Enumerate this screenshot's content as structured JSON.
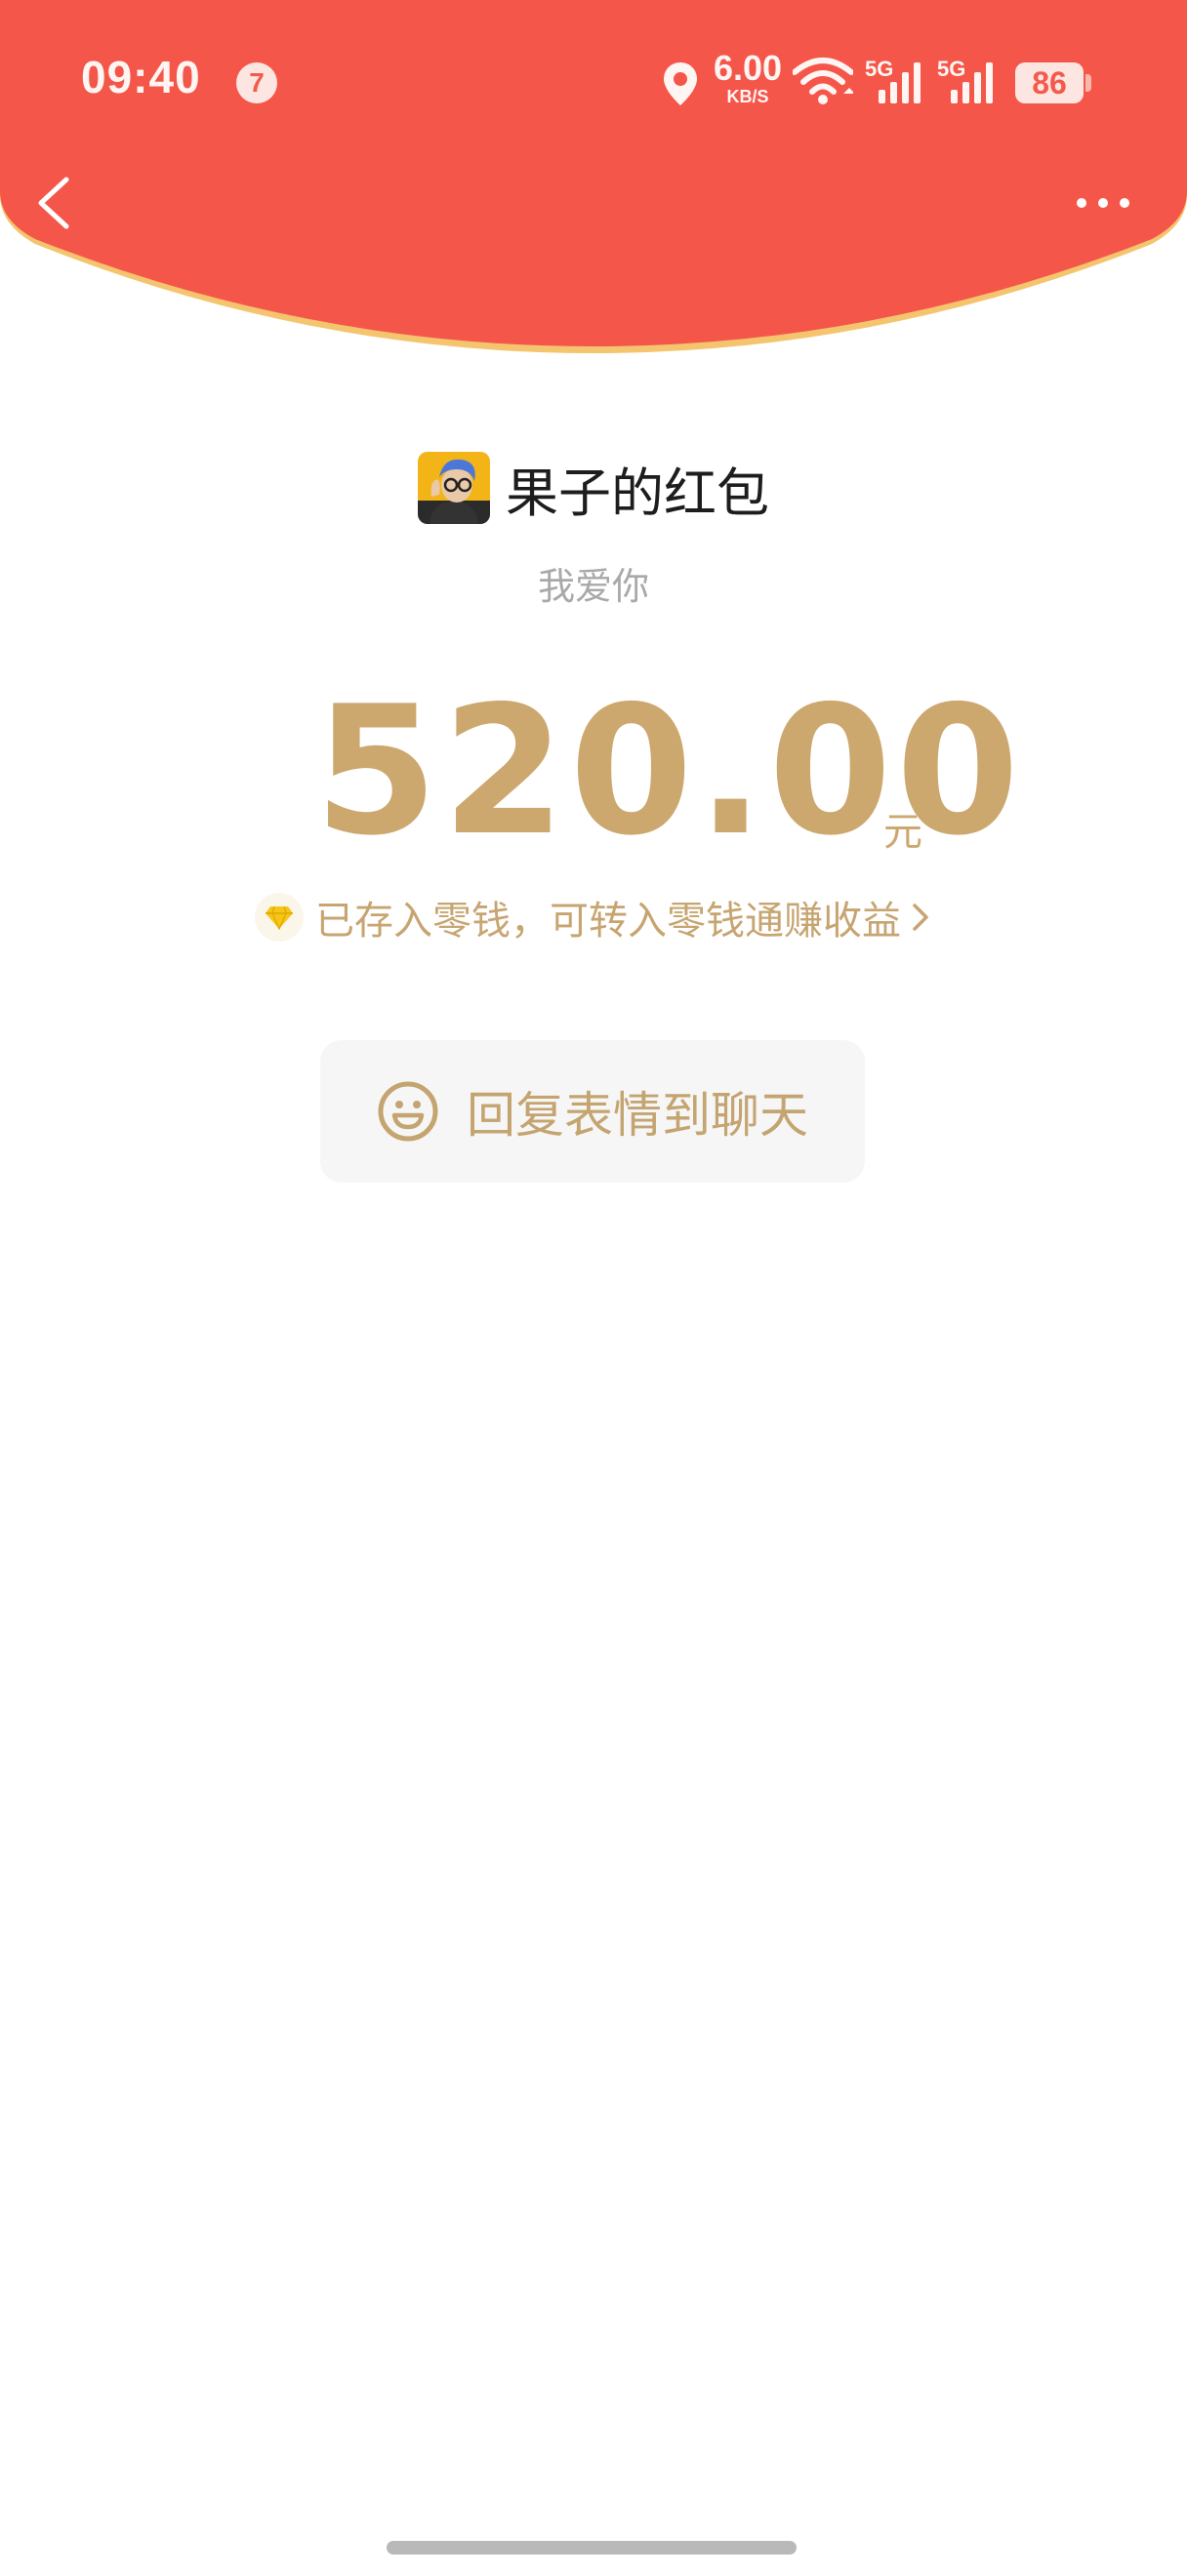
{
  "status_bar": {
    "time": "09:40",
    "notification_count": "7",
    "net_speed_value": "6.00",
    "net_speed_unit": "KB/S",
    "signal_1_label": "5G",
    "signal_2_label": "5G",
    "battery_level": "86"
  },
  "nav": {
    "back_icon": "chevron-left-icon",
    "more_icon": "more-dots-icon"
  },
  "packet": {
    "sender_title": "果子的红包",
    "greeting": "我爱你",
    "amount": "520.00",
    "unit": "元",
    "wallet_notice": "已存入零钱，可转入零钱通赚收益",
    "reply_label": "回复表情到聊天"
  },
  "colors": {
    "header_red": "#f5564a",
    "header_edge": "#f4c56e",
    "gold_text": "#cca86f",
    "button_bg": "#f6f6f6"
  }
}
